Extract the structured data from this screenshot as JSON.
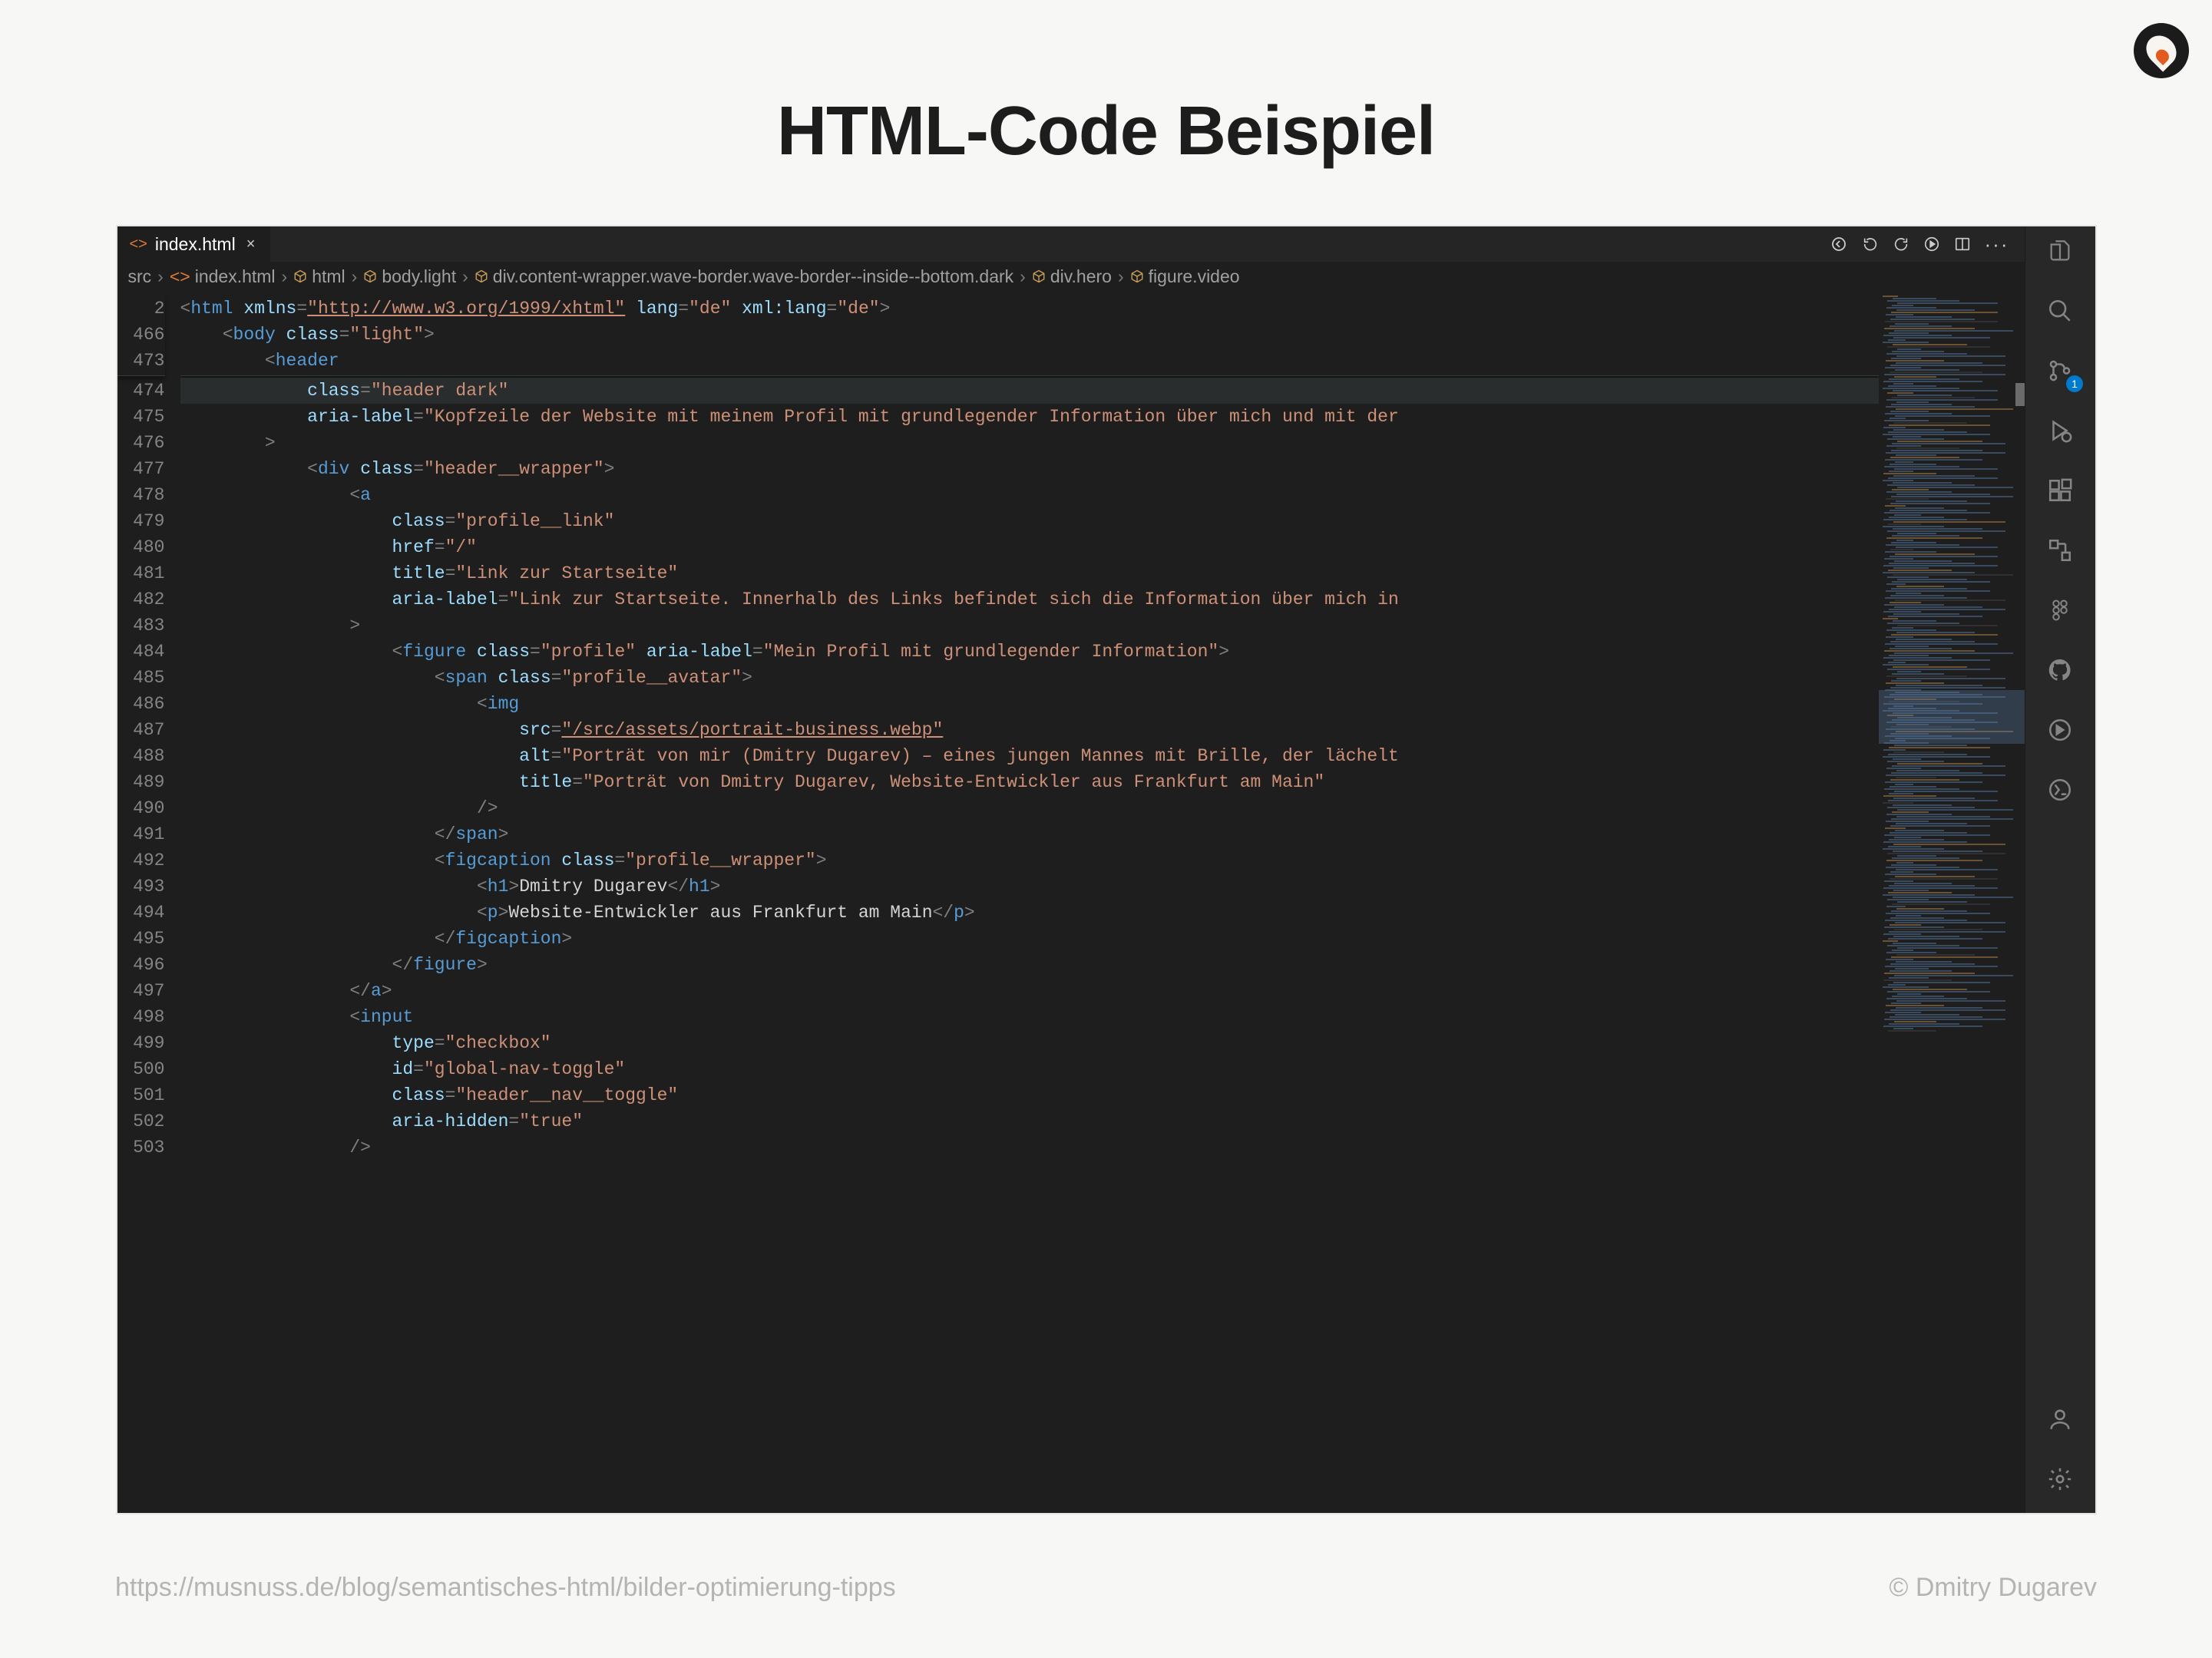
{
  "page": {
    "title": "HTML-Code Beispiel",
    "footer_url": "https://musnuss.de/blog/semantisches-html/bilder-optimierung-tipps",
    "copyright": "© Dmitry Dugarev"
  },
  "tab": {
    "filename": "index.html",
    "close_glyph": "×"
  },
  "breadcrumb": [
    {
      "label": "src",
      "icon": ""
    },
    {
      "label": "index.html",
      "icon": "code"
    },
    {
      "label": "html",
      "icon": "box"
    },
    {
      "label": "body.light",
      "icon": "box"
    },
    {
      "label": "div.content-wrapper.wave-border.wave-border--inside--bottom.dark",
      "icon": "box"
    },
    {
      "label": "div.hero",
      "icon": "box"
    },
    {
      "label": "figure.video",
      "icon": "box"
    }
  ],
  "gutter_sticky": [
    "2",
    "466",
    "473"
  ],
  "gutter_lines": [
    "474",
    "475",
    "476",
    "477",
    "478",
    "479",
    "480",
    "481",
    "482",
    "483",
    "484",
    "485",
    "486",
    "487",
    "488",
    "489",
    "490",
    "491",
    "492",
    "493",
    "494",
    "495",
    "496",
    "497",
    "498",
    "499",
    "500",
    "501",
    "502",
    "503"
  ],
  "code": {
    "sticky": [
      {
        "indent": 0,
        "tokens": [
          [
            "bracket",
            "<"
          ],
          [
            "tag",
            "html"
          ],
          [
            "text",
            " "
          ],
          [
            "attr",
            "xmlns"
          ],
          [
            "bracket",
            "="
          ],
          [
            "url",
            "\"http://www.w3.org/1999/xhtml\""
          ],
          [
            "text",
            " "
          ],
          [
            "attr",
            "lang"
          ],
          [
            "bracket",
            "="
          ],
          [
            "str",
            "\"de\""
          ],
          [
            "text",
            " "
          ],
          [
            "attr",
            "xml:lang"
          ],
          [
            "bracket",
            "="
          ],
          [
            "str",
            "\"de\""
          ],
          [
            "bracket",
            ">"
          ]
        ]
      },
      {
        "indent": 1,
        "tokens": [
          [
            "bracket",
            "<"
          ],
          [
            "tag",
            "body"
          ],
          [
            "text",
            " "
          ],
          [
            "attr",
            "class"
          ],
          [
            "bracket",
            "="
          ],
          [
            "str",
            "\"light\""
          ],
          [
            "bracket",
            ">"
          ]
        ]
      },
      {
        "indent": 2,
        "tokens": [
          [
            "bracket",
            "<"
          ],
          [
            "tag",
            "header"
          ]
        ]
      }
    ],
    "body": [
      {
        "indent": 3,
        "hl": true,
        "tokens": [
          [
            "attr",
            "class"
          ],
          [
            "bracket",
            "="
          ],
          [
            "str",
            "\"header dark\""
          ]
        ]
      },
      {
        "indent": 3,
        "tokens": [
          [
            "attr",
            "aria-label"
          ],
          [
            "bracket",
            "="
          ],
          [
            "str",
            "\"Kopfzeile der Website mit meinem Profil mit grundlegender Information über mich und mit der"
          ]
        ]
      },
      {
        "indent": 2,
        "tokens": [
          [
            "bracket",
            ">"
          ]
        ]
      },
      {
        "indent": 3,
        "tokens": [
          [
            "bracket",
            "<"
          ],
          [
            "tag",
            "div"
          ],
          [
            "text",
            " "
          ],
          [
            "attr",
            "class"
          ],
          [
            "bracket",
            "="
          ],
          [
            "str",
            "\"header__wrapper\""
          ],
          [
            "bracket",
            ">"
          ]
        ]
      },
      {
        "indent": 4,
        "tokens": [
          [
            "bracket",
            "<"
          ],
          [
            "tag",
            "a"
          ]
        ]
      },
      {
        "indent": 5,
        "tokens": [
          [
            "attr",
            "class"
          ],
          [
            "bracket",
            "="
          ],
          [
            "str",
            "\"profile__link\""
          ]
        ]
      },
      {
        "indent": 5,
        "tokens": [
          [
            "attr",
            "href"
          ],
          [
            "bracket",
            "="
          ],
          [
            "str",
            "\"/\""
          ]
        ]
      },
      {
        "indent": 5,
        "tokens": [
          [
            "attr",
            "title"
          ],
          [
            "bracket",
            "="
          ],
          [
            "str",
            "\"Link zur Startseite\""
          ]
        ]
      },
      {
        "indent": 5,
        "tokens": [
          [
            "attr",
            "aria-label"
          ],
          [
            "bracket",
            "="
          ],
          [
            "str",
            "\"Link zur Startseite. Innerhalb des Links befindet sich die Information über mich in"
          ]
        ]
      },
      {
        "indent": 4,
        "tokens": [
          [
            "bracket",
            ">"
          ]
        ]
      },
      {
        "indent": 5,
        "tokens": [
          [
            "bracket",
            "<"
          ],
          [
            "tag",
            "figure"
          ],
          [
            "text",
            " "
          ],
          [
            "attr",
            "class"
          ],
          [
            "bracket",
            "="
          ],
          [
            "str",
            "\"profile\""
          ],
          [
            "text",
            " "
          ],
          [
            "attr",
            "aria-label"
          ],
          [
            "bracket",
            "="
          ],
          [
            "str",
            "\"Mein Profil mit grundlegender Information\""
          ],
          [
            "bracket",
            ">"
          ]
        ]
      },
      {
        "indent": 6,
        "tokens": [
          [
            "bracket",
            "<"
          ],
          [
            "tag",
            "span"
          ],
          [
            "text",
            " "
          ],
          [
            "attr",
            "class"
          ],
          [
            "bracket",
            "="
          ],
          [
            "str",
            "\"profile__avatar\""
          ],
          [
            "bracket",
            ">"
          ]
        ]
      },
      {
        "indent": 7,
        "tokens": [
          [
            "bracket",
            "<"
          ],
          [
            "tag",
            "img"
          ]
        ]
      },
      {
        "indent": 8,
        "tokens": [
          [
            "attr",
            "src"
          ],
          [
            "bracket",
            "="
          ],
          [
            "url",
            "\"/src/assets/portrait-business.webp\""
          ]
        ]
      },
      {
        "indent": 8,
        "tokens": [
          [
            "attr",
            "alt"
          ],
          [
            "bracket",
            "="
          ],
          [
            "str",
            "\"Porträt von mir (Dmitry Dugarev) – eines jungen Mannes mit Brille, der lächelt"
          ]
        ]
      },
      {
        "indent": 8,
        "tokens": [
          [
            "attr",
            "title"
          ],
          [
            "bracket",
            "="
          ],
          [
            "str",
            "\"Porträt von Dmitry Dugarev, Website-Entwickler aus Frankfurt am Main\""
          ]
        ]
      },
      {
        "indent": 7,
        "tokens": [
          [
            "bracket",
            "/>"
          ]
        ]
      },
      {
        "indent": 6,
        "tokens": [
          [
            "bracket",
            "</"
          ],
          [
            "tag",
            "span"
          ],
          [
            "bracket",
            ">"
          ]
        ]
      },
      {
        "indent": 6,
        "tokens": [
          [
            "bracket",
            "<"
          ],
          [
            "tag",
            "figcaption"
          ],
          [
            "text",
            " "
          ],
          [
            "attr",
            "class"
          ],
          [
            "bracket",
            "="
          ],
          [
            "str",
            "\"profile__wrapper\""
          ],
          [
            "bracket",
            ">"
          ]
        ]
      },
      {
        "indent": 7,
        "tokens": [
          [
            "bracket",
            "<"
          ],
          [
            "tag",
            "h1"
          ],
          [
            "bracket",
            ">"
          ],
          [
            "text",
            "Dmitry Dugarev"
          ],
          [
            "bracket",
            "</"
          ],
          [
            "tag",
            "h1"
          ],
          [
            "bracket",
            ">"
          ]
        ]
      },
      {
        "indent": 7,
        "tokens": [
          [
            "bracket",
            "<"
          ],
          [
            "tag",
            "p"
          ],
          [
            "bracket",
            ">"
          ],
          [
            "text",
            "Website-Entwickler aus Frankfurt am Main"
          ],
          [
            "bracket",
            "</"
          ],
          [
            "tag",
            "p"
          ],
          [
            "bracket",
            ">"
          ]
        ]
      },
      {
        "indent": 6,
        "tokens": [
          [
            "bracket",
            "</"
          ],
          [
            "tag",
            "figcaption"
          ],
          [
            "bracket",
            ">"
          ]
        ]
      },
      {
        "indent": 5,
        "tokens": [
          [
            "bracket",
            "</"
          ],
          [
            "tag",
            "figure"
          ],
          [
            "bracket",
            ">"
          ]
        ]
      },
      {
        "indent": 4,
        "tokens": [
          [
            "bracket",
            "</"
          ],
          [
            "tag",
            "a"
          ],
          [
            "bracket",
            ">"
          ]
        ]
      },
      {
        "indent": 4,
        "tokens": [
          [
            "bracket",
            "<"
          ],
          [
            "tag",
            "input"
          ]
        ]
      },
      {
        "indent": 5,
        "tokens": [
          [
            "attr",
            "type"
          ],
          [
            "bracket",
            "="
          ],
          [
            "str",
            "\"checkbox\""
          ]
        ]
      },
      {
        "indent": 5,
        "tokens": [
          [
            "attr",
            "id"
          ],
          [
            "bracket",
            "="
          ],
          [
            "str",
            "\"global-nav-toggle\""
          ]
        ]
      },
      {
        "indent": 5,
        "tokens": [
          [
            "attr",
            "class"
          ],
          [
            "bracket",
            "="
          ],
          [
            "str",
            "\"header__nav__toggle\""
          ]
        ]
      },
      {
        "indent": 5,
        "tokens": [
          [
            "attr",
            "aria-hidden"
          ],
          [
            "bracket",
            "="
          ],
          [
            "str",
            "\"true\""
          ]
        ]
      },
      {
        "indent": 4,
        "tokens": [
          [
            "bracket",
            "/>"
          ]
        ]
      }
    ]
  },
  "scm_badge": "1",
  "colors": {
    "bg": "#1e1e1e",
    "tag": "#569cd6",
    "attr": "#9cdcfe",
    "string": "#ce9178"
  }
}
